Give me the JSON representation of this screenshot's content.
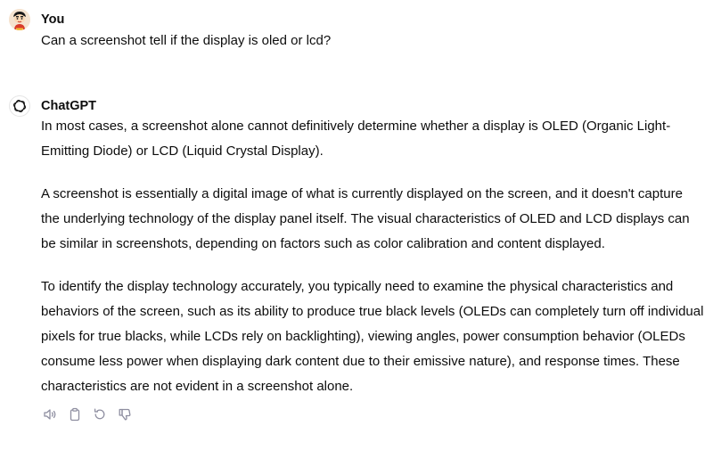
{
  "conversation": {
    "user": {
      "author": "You",
      "avatar_icon": "cartoon-character-avatar",
      "message": "Can a screenshot tell if the display is oled or lcd?"
    },
    "assistant": {
      "author": "ChatGPT",
      "avatar_icon": "openai-logo-icon",
      "paragraphs": [
        "In most cases, a screenshot alone cannot definitively determine whether a display is OLED (Organic Light-Emitting Diode) or LCD (Liquid Crystal Display).",
        "A screenshot is essentially a digital image of what is currently displayed on the screen, and it doesn't capture the underlying technology of the display panel itself. The visual characteristics of OLED and LCD displays can be similar in screenshots, depending on factors such as color calibration and content displayed.",
        "To identify the display technology accurately, you typically need to examine the physical characteristics and behaviors of the screen, such as its ability to produce true black levels (OLEDs can completely turn off individual pixels for true blacks, while LCDs rely on backlighting), viewing angles, power consumption behavior (OLEDs consume less power when displaying dark content due to their emissive nature), and response times. These characteristics are not evident in a screenshot alone."
      ],
      "actions": [
        {
          "icon": "speaker-icon"
        },
        {
          "icon": "clipboard-icon"
        },
        {
          "icon": "regenerate-icon"
        },
        {
          "icon": "thumbs-down-icon"
        }
      ]
    }
  },
  "colors": {
    "text": "#0d0d0d",
    "icon": "#8e8ea0",
    "background": "#ffffff"
  }
}
